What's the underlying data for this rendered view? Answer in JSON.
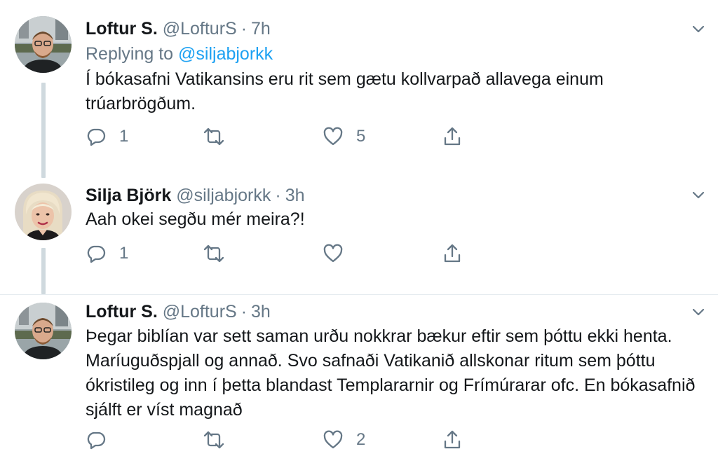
{
  "tweets": [
    {
      "name": "Loftur S.",
      "handle": "@LofturS",
      "dot": "·",
      "time": "7h",
      "replying_prefix": "Replying to",
      "replying_to": "@siljabjorkk",
      "text": "Í bókasafni Vatikansins eru rit sem gætu kollvarpað allavega einum trúarbrögðum.",
      "replies": "1",
      "retweets": "",
      "likes": "5"
    },
    {
      "name": "Silja Björk",
      "handle": "@siljabjorkk",
      "dot": "·",
      "time": "3h",
      "text": "Aah okei segðu mér meira?!",
      "replies": "1",
      "retweets": "",
      "likes": ""
    },
    {
      "name": "Loftur S.",
      "handle": "@LofturS",
      "dot": "·",
      "time": "3h",
      "text": "Þegar biblían var sett saman urðu nokkrar bækur eftir sem þóttu ekki henta. Maríuguðspjall og annað. Svo safnaði Vatikanið allskonar ritum sem þóttu ókristileg og inn í þetta blandast Templararnir og Frímúrarar ofc.  En bókasafnið sjálft er víst magnað",
      "replies": "",
      "retweets": "",
      "likes": "2"
    }
  ],
  "icons": {
    "reply": "reply-icon",
    "retweet": "retweet-icon",
    "like": "heart-icon",
    "share": "share-icon",
    "caret": "chevron-down-icon"
  },
  "colors": {
    "text": "#14171a",
    "secondary": "#657786",
    "accent": "#1da1f2",
    "thread_line": "#cfd9de"
  }
}
